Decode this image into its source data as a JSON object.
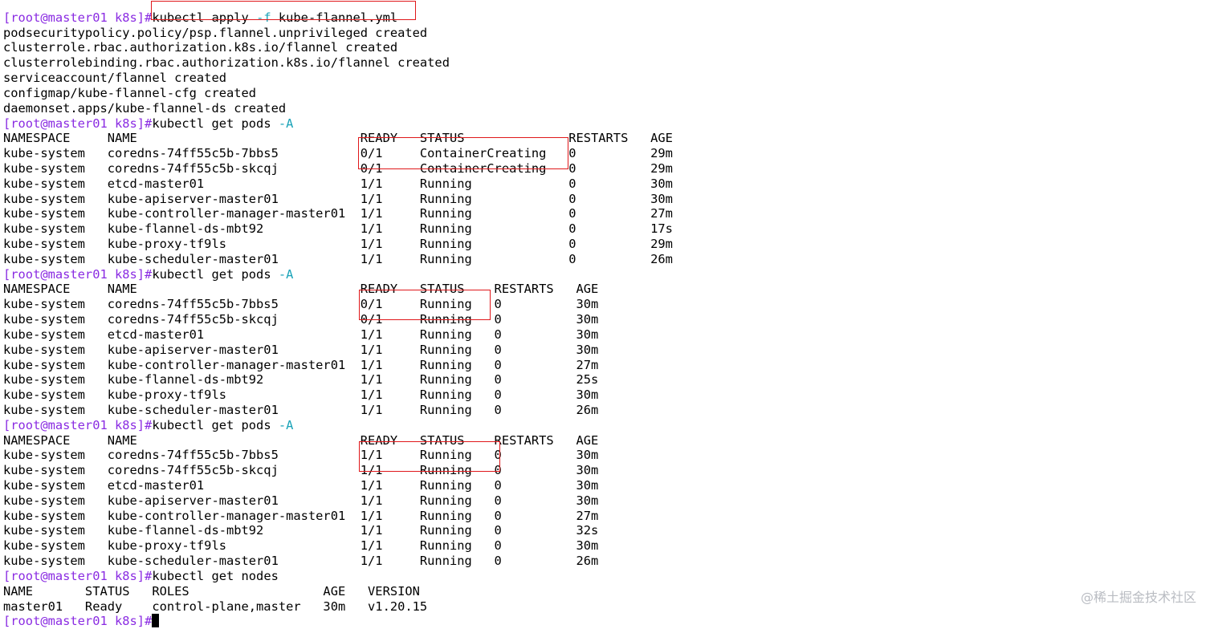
{
  "terminal": {
    "prompt": "[root@master01 k8s]#",
    "lines": [
      {
        "type": "text",
        "text": "                  "
      },
      {
        "type": "cmd",
        "cmd": "kubectl apply ",
        "flag": "-f",
        "rest": " kube-flannel.yml"
      },
      {
        "type": "text",
        "text": "podsecuritypolicy.policy/psp.flannel.unprivileged created"
      },
      {
        "type": "text",
        "text": "clusterrole.rbac.authorization.k8s.io/flannel created"
      },
      {
        "type": "text",
        "text": "clusterrolebinding.rbac.authorization.k8s.io/flannel created"
      },
      {
        "type": "text",
        "text": "serviceaccount/flannel created"
      },
      {
        "type": "text",
        "text": "configmap/kube-flannel-cfg created"
      },
      {
        "type": "text",
        "text": "daemonset.apps/kube-flannel-ds created"
      },
      {
        "type": "cmd",
        "cmd": "kubectl get pods ",
        "flag": "-A",
        "rest": ""
      },
      {
        "type": "text",
        "text": "NAMESPACE     NAME                              READY   STATUS              RESTARTS   AGE"
      },
      {
        "type": "text",
        "text": "kube-system   coredns-74ff55c5b-7bbs5           0/1     ContainerCreating   0          29m"
      },
      {
        "type": "text",
        "text": "kube-system   coredns-74ff55c5b-skcqj           0/1     ContainerCreating   0          29m"
      },
      {
        "type": "text",
        "text": "kube-system   etcd-master01                     1/1     Running             0          30m"
      },
      {
        "type": "text",
        "text": "kube-system   kube-apiserver-master01           1/1     Running             0          30m"
      },
      {
        "type": "text",
        "text": "kube-system   kube-controller-manager-master01  1/1     Running             0          27m"
      },
      {
        "type": "text",
        "text": "kube-system   kube-flannel-ds-mbt92             1/1     Running             0          17s"
      },
      {
        "type": "text",
        "text": "kube-system   kube-proxy-tf9ls                  1/1     Running             0          29m"
      },
      {
        "type": "text",
        "text": "kube-system   kube-scheduler-master01           1/1     Running             0          26m"
      },
      {
        "type": "cmd",
        "cmd": "kubectl get pods ",
        "flag": "-A",
        "rest": ""
      },
      {
        "type": "text",
        "text": "NAMESPACE     NAME                              READY   STATUS    RESTARTS   AGE"
      },
      {
        "type": "text",
        "text": "kube-system   coredns-74ff55c5b-7bbs5           0/1     Running   0          30m"
      },
      {
        "type": "text",
        "text": "kube-system   coredns-74ff55c5b-skcqj           0/1     Running   0          30m"
      },
      {
        "type": "text",
        "text": "kube-system   etcd-master01                     1/1     Running   0          30m"
      },
      {
        "type": "text",
        "text": "kube-system   kube-apiserver-master01           1/1     Running   0          30m"
      },
      {
        "type": "text",
        "text": "kube-system   kube-controller-manager-master01  1/1     Running   0          27m"
      },
      {
        "type": "text",
        "text": "kube-system   kube-flannel-ds-mbt92             1/1     Running   0          25s"
      },
      {
        "type": "text",
        "text": "kube-system   kube-proxy-tf9ls                  1/1     Running   0          30m"
      },
      {
        "type": "text",
        "text": "kube-system   kube-scheduler-master01           1/1     Running   0          26m"
      },
      {
        "type": "cmd",
        "cmd": "kubectl get pods ",
        "flag": "-A",
        "rest": ""
      },
      {
        "type": "text",
        "text": "NAMESPACE     NAME                              READY   STATUS    RESTARTS   AGE"
      },
      {
        "type": "text",
        "text": "kube-system   coredns-74ff55c5b-7bbs5           1/1     Running   0          30m"
      },
      {
        "type": "text",
        "text": "kube-system   coredns-74ff55c5b-skcqj           1/1     Running   0          30m"
      },
      {
        "type": "text",
        "text": "kube-system   etcd-master01                     1/1     Running   0          30m"
      },
      {
        "type": "text",
        "text": "kube-system   kube-apiserver-master01           1/1     Running   0          30m"
      },
      {
        "type": "text",
        "text": "kube-system   kube-controller-manager-master01  1/1     Running   0          27m"
      },
      {
        "type": "text",
        "text": "kube-system   kube-flannel-ds-mbt92             1/1     Running   0          32s"
      },
      {
        "type": "text",
        "text": "kube-system   kube-proxy-tf9ls                  1/1     Running   0          30m"
      },
      {
        "type": "text",
        "text": "kube-system   kube-scheduler-master01           1/1     Running   0          26m"
      },
      {
        "type": "cmd",
        "cmd": "kubectl get nodes",
        "flag": "",
        "rest": ""
      },
      {
        "type": "text",
        "text": "NAME       STATUS   ROLES                  AGE   VERSION"
      },
      {
        "type": "text",
        "text": "master01   Ready    control-plane,master   30m   v1.20.15"
      },
      {
        "type": "cursor"
      }
    ]
  },
  "watermark": "@稀土掘金技术社区",
  "colors": {
    "prompt": "#8a2be2",
    "flag": "#1aa3b8",
    "highlight_border": "#e0181b",
    "background": "#ffffff",
    "text": "#000000"
  }
}
